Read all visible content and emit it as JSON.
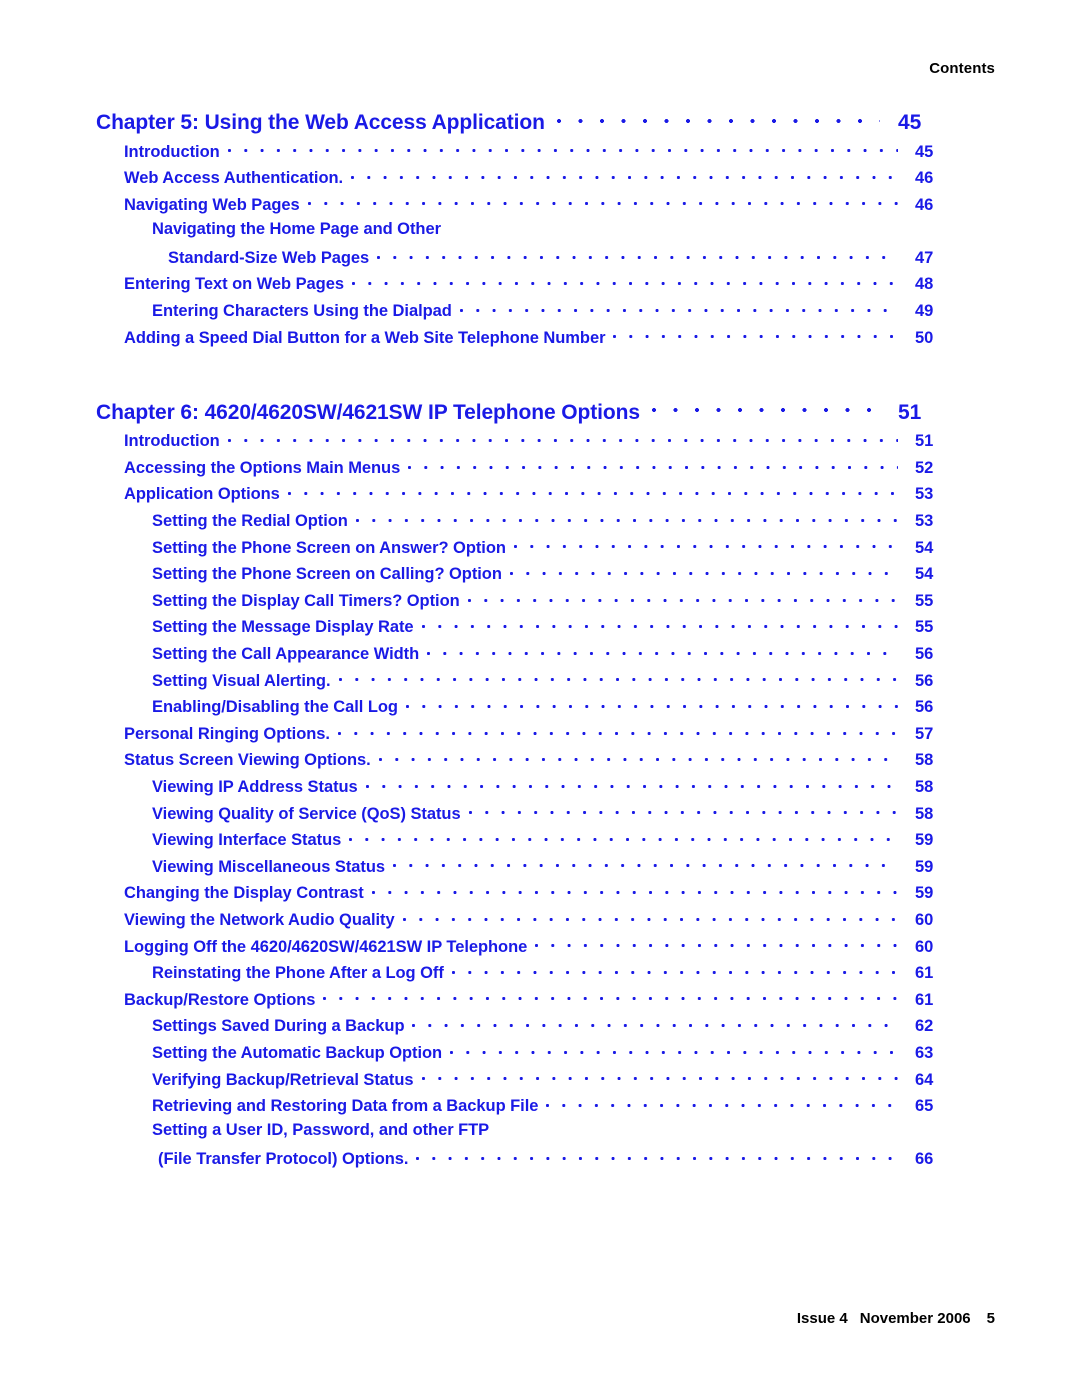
{
  "header": {
    "running_head": "Contents"
  },
  "footer": {
    "issue": "Issue 4",
    "date": "November 2006",
    "page_number": "5"
  },
  "colors": {
    "toc_link": "#1A1AE6",
    "text": "#000000",
    "background": "#FFFFFF"
  },
  "toc": {
    "chapter5": {
      "title": "Chapter 5: Using the Web Access Application",
      "page": "45",
      "entries": [
        {
          "title": "Introduction",
          "page": "45",
          "level": 1
        },
        {
          "title": "Web Access Authentication.",
          "page": "46",
          "level": 1
        },
        {
          "title": "Navigating Web Pages",
          "page": "46",
          "level": 1
        },
        {
          "title": "Navigating the Home Page and Other",
          "title2": "Standard-Size Web Pages",
          "page": "47",
          "level": 2
        },
        {
          "title": "Entering Text on Web Pages",
          "page": "48",
          "level": 1
        },
        {
          "title": "Entering Characters Using the Dialpad",
          "page": "49",
          "level": 2
        },
        {
          "title": "Adding a Speed Dial Button for a Web Site Telephone Number",
          "page": "50",
          "level": 1
        }
      ]
    },
    "chapter6": {
      "title": "Chapter 6: 4620/4620SW/4621SW IP Telephone Options",
      "page": "51",
      "entries": [
        {
          "title": "Introduction",
          "page": "51",
          "level": 1
        },
        {
          "title": "Accessing the Options Main Menus",
          "page": "52",
          "level": 1
        },
        {
          "title": "Application Options",
          "page": "53",
          "level": 1
        },
        {
          "title": "Setting the Redial Option",
          "page": "53",
          "level": 2
        },
        {
          "title": "Setting the Phone Screen on Answer? Option",
          "page": "54",
          "level": 2
        },
        {
          "title": "Setting the Phone Screen on Calling? Option",
          "page": "54",
          "level": 2
        },
        {
          "title": "Setting the Display Call Timers? Option",
          "page": "55",
          "level": 2
        },
        {
          "title": "Setting the Message Display Rate",
          "page": "55",
          "level": 2
        },
        {
          "title": "Setting the Call Appearance Width",
          "page": "56",
          "level": 2
        },
        {
          "title": "Setting Visual Alerting.",
          "page": "56",
          "level": 2
        },
        {
          "title": "Enabling/Disabling the Call Log",
          "page": "56",
          "level": 2
        },
        {
          "title": "Personal Ringing Options.",
          "page": "57",
          "level": 1
        },
        {
          "title": "Status Screen Viewing Options.",
          "page": "58",
          "level": 1
        },
        {
          "title": "Viewing IP Address Status",
          "page": "58",
          "level": 2
        },
        {
          "title": "Viewing Quality of Service (QoS) Status",
          "page": "58",
          "level": 2
        },
        {
          "title": "Viewing Interface Status",
          "page": "59",
          "level": 2
        },
        {
          "title": "Viewing Miscellaneous Status",
          "page": "59",
          "level": 2
        },
        {
          "title": "Changing the Display Contrast",
          "page": "59",
          "level": 1
        },
        {
          "title": "Viewing the Network Audio Quality",
          "page": "60",
          "level": 1
        },
        {
          "title": "Logging Off the 4620/4620SW/4621SW IP Telephone",
          "page": "60",
          "level": 1
        },
        {
          "title": "Reinstating the Phone After a Log Off",
          "page": "61",
          "level": 2
        },
        {
          "title": "Backup/Restore Options",
          "page": "61",
          "level": 1
        },
        {
          "title": "Settings Saved During a Backup",
          "page": "62",
          "level": 2
        },
        {
          "title": "Setting the Automatic Backup Option",
          "page": "63",
          "level": 2
        },
        {
          "title": "Verifying Backup/Retrieval Status",
          "page": "64",
          "level": 2
        },
        {
          "title": "Retrieving and Restoring Data from a Backup File",
          "page": "65",
          "level": 2
        },
        {
          "title": "Setting a User ID, Password, and other FTP",
          "title2": "(File Transfer Protocol) Options.",
          "page": "66",
          "level": 2
        }
      ]
    }
  }
}
